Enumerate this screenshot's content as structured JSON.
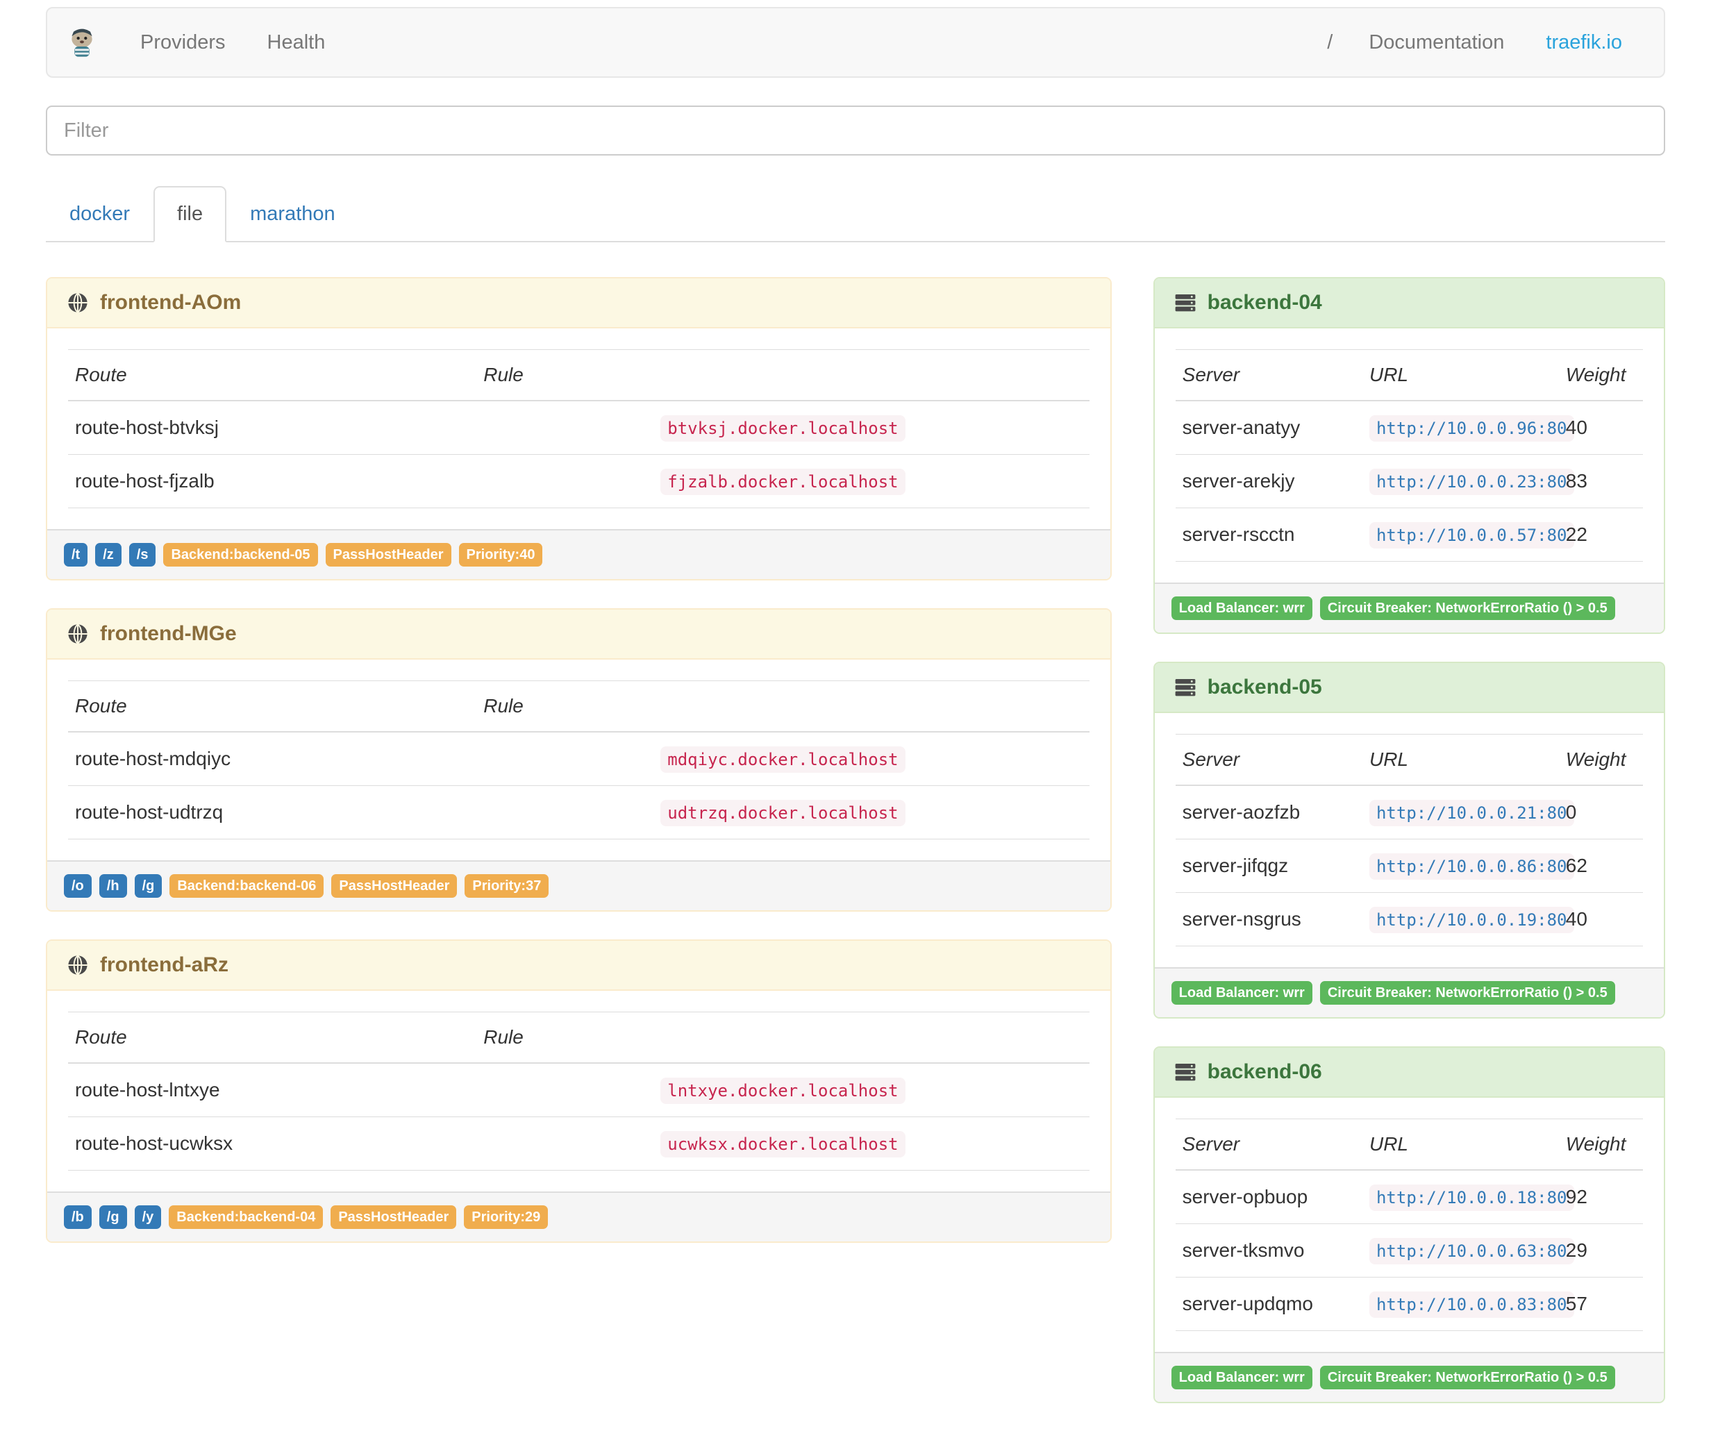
{
  "navbar": {
    "links": [
      "Providers",
      "Health"
    ],
    "separator": "/",
    "doc_link": "Documentation",
    "site_link": "traefik.io"
  },
  "filter": {
    "placeholder": "Filter",
    "value": ""
  },
  "tabs": [
    {
      "label": "docker",
      "active": false
    },
    {
      "label": "file",
      "active": true
    },
    {
      "label": "marathon",
      "active": false
    }
  ],
  "table_headers": {
    "route": "Route",
    "rule": "Rule",
    "server": "Server",
    "url": "URL",
    "weight": "Weight"
  },
  "frontends": [
    {
      "title": "frontend-AOm",
      "routes": [
        {
          "route": "route-host-btvksj",
          "rule": "btvksj.docker.localhost"
        },
        {
          "route": "route-host-fjzalb",
          "rule": "fjzalb.docker.localhost"
        }
      ],
      "entry_points": [
        "/t",
        "/z",
        "/s"
      ],
      "badges": [
        "Backend:backend-05",
        "PassHostHeader",
        "Priority:40"
      ]
    },
    {
      "title": "frontend-MGe",
      "routes": [
        {
          "route": "route-host-mdqiyc",
          "rule": "mdqiyc.docker.localhost"
        },
        {
          "route": "route-host-udtrzq",
          "rule": "udtrzq.docker.localhost"
        }
      ],
      "entry_points": [
        "/o",
        "/h",
        "/g"
      ],
      "badges": [
        "Backend:backend-06",
        "PassHostHeader",
        "Priority:37"
      ]
    },
    {
      "title": "frontend-aRz",
      "routes": [
        {
          "route": "route-host-lntxye",
          "rule": "lntxye.docker.localhost"
        },
        {
          "route": "route-host-ucwksx",
          "rule": "ucwksx.docker.localhost"
        }
      ],
      "entry_points": [
        "/b",
        "/g",
        "/y"
      ],
      "badges": [
        "Backend:backend-04",
        "PassHostHeader",
        "Priority:29"
      ]
    }
  ],
  "backends": [
    {
      "title": "backend-04",
      "servers": [
        {
          "name": "server-anatyy",
          "url": "http://10.0.0.96:80",
          "weight": 40
        },
        {
          "name": "server-arekjy",
          "url": "http://10.0.0.23:80",
          "weight": 83
        },
        {
          "name": "server-rscctn",
          "url": "http://10.0.0.57:80",
          "weight": 22
        }
      ],
      "badges": [
        "Load Balancer: wrr",
        "Circuit Breaker: NetworkErrorRatio () > 0.5"
      ]
    },
    {
      "title": "backend-05",
      "servers": [
        {
          "name": "server-aozfzb",
          "url": "http://10.0.0.21:80",
          "weight": 0
        },
        {
          "name": "server-jifqgz",
          "url": "http://10.0.0.86:80",
          "weight": 62
        },
        {
          "name": "server-nsgrus",
          "url": "http://10.0.0.19:80",
          "weight": 40
        }
      ],
      "badges": [
        "Load Balancer: wrr",
        "Circuit Breaker: NetworkErrorRatio () > 0.5"
      ]
    },
    {
      "title": "backend-06",
      "servers": [
        {
          "name": "server-opbuop",
          "url": "http://10.0.0.18:80",
          "weight": 92
        },
        {
          "name": "server-tksmvo",
          "url": "http://10.0.0.63:80",
          "weight": 29
        },
        {
          "name": "server-updqmo",
          "url": "http://10.0.0.83:80",
          "weight": 57
        }
      ],
      "badges": [
        "Load Balancer: wrr",
        "Circuit Breaker: NetworkErrorRatio () > 0.5"
      ]
    }
  ],
  "colors": {
    "link_blue": "#337ab7",
    "brand_blue": "#2aa3dc",
    "label_blue": "#337ab7",
    "label_orange": "#f0ad4e",
    "label_green": "#5cb85c",
    "frontend_heading_bg": "#fcf8e3",
    "frontend_heading_text": "#8a6d3b",
    "frontend_border": "#faebcc",
    "backend_heading_bg": "#dff0d8",
    "backend_heading_text": "#3c763d",
    "backend_border": "#d6e9c6",
    "code_text": "#c7254e",
    "code_bg": "#f9f2f4"
  }
}
